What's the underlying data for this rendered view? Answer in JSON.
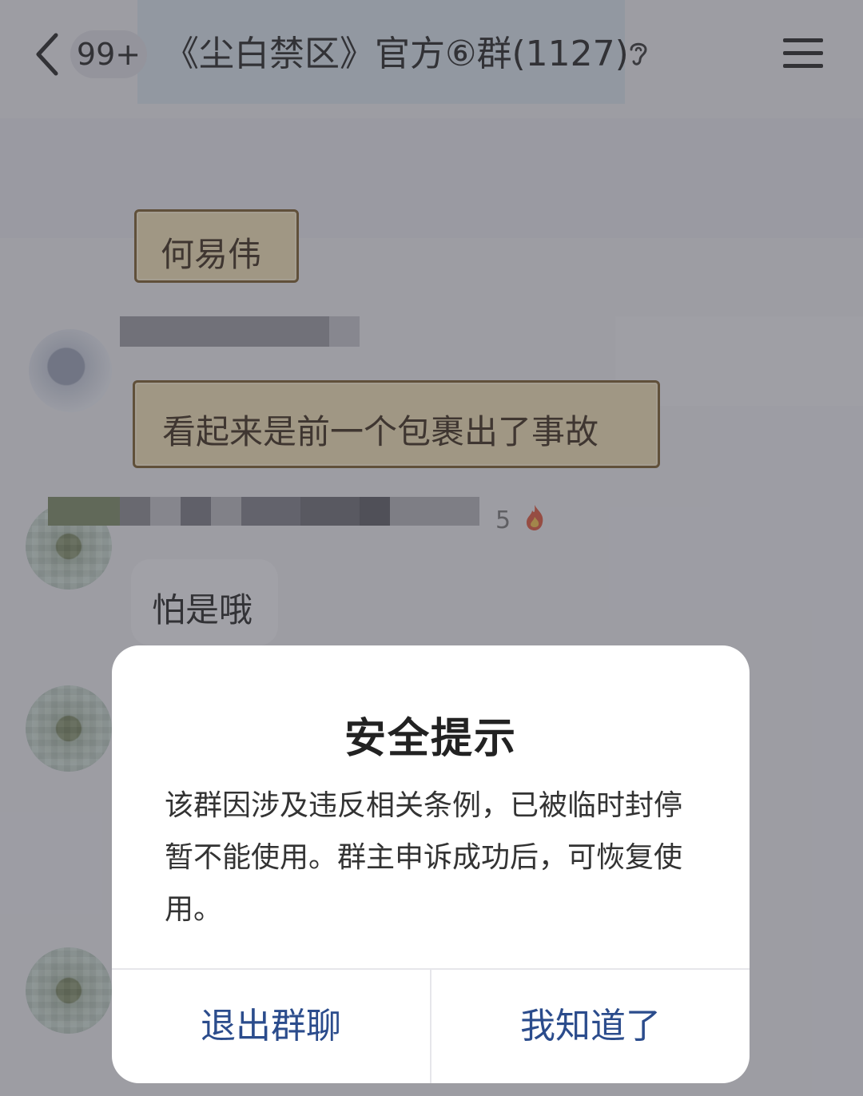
{
  "header": {
    "back_icon": "chevron-left-icon",
    "unread_badge": "99+",
    "title": "《尘白禁区》官方⑥群(1127)",
    "ear_icon": "ear-icon",
    "menu_icon": "menu-icon"
  },
  "messages": [
    {
      "text": "何易伟"
    },
    {
      "text": "看起来是前一个包裹出了事故"
    },
    {
      "level": "5",
      "level_icon": "fire-icon"
    },
    {
      "text": "怕是哦"
    }
  ],
  "dialog": {
    "title": "安全提示",
    "body": "该群因涉及违反相关条例，已被临时封停暂不能使用。群主申诉成功后，可恢复使用。",
    "buttons": {
      "exit": "退出群聊",
      "ok": "我知道了"
    },
    "button_color": "#2b4c8c"
  }
}
